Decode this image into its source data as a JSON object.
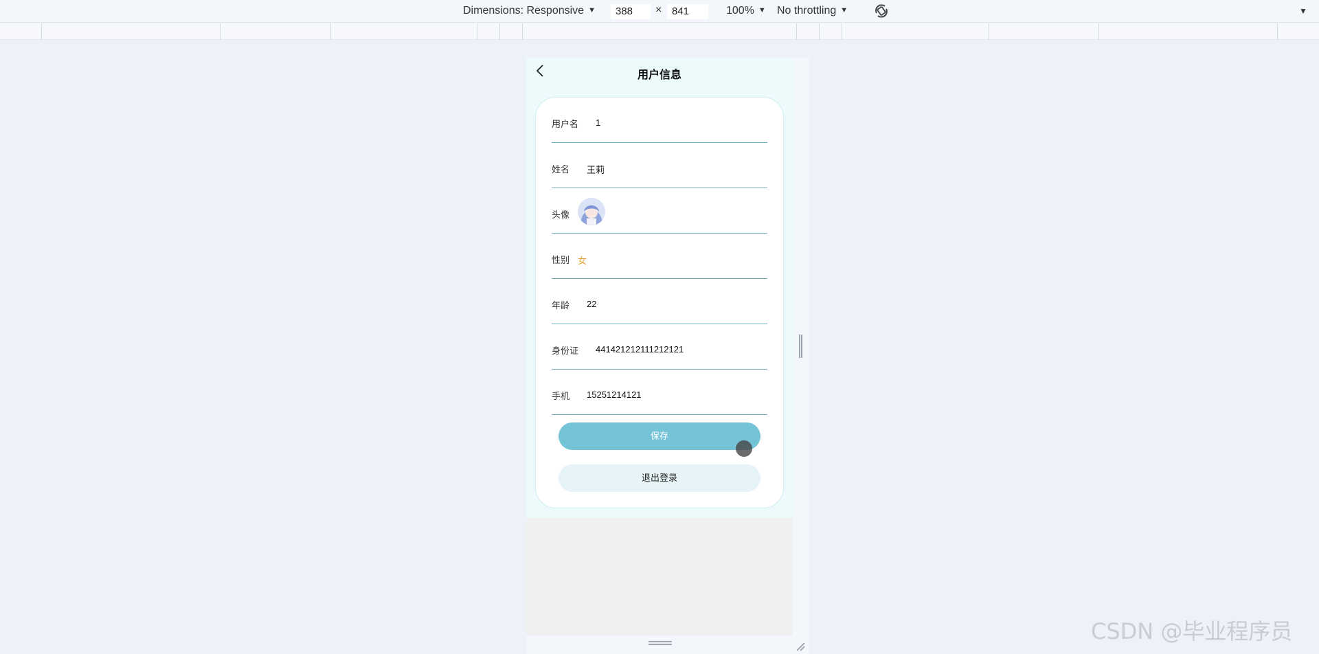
{
  "devtools": {
    "dimensions_label": "Dimensions: Responsive",
    "width_value": "388",
    "times_sign": "×",
    "height_value": "841",
    "zoom_label": "100%",
    "throttling_label": "No throttling",
    "dropdown_caret": "▼"
  },
  "app": {
    "title": "用户信息",
    "fields": [
      {
        "label": "用户名",
        "value": "1"
      },
      {
        "label": "姓名",
        "value": "王莉"
      },
      {
        "label": "头像",
        "value": ""
      },
      {
        "label": "性别",
        "value": "女"
      },
      {
        "label": "年龄",
        "value": "22"
      },
      {
        "label": "身份证",
        "value": "441421212111212121"
      },
      {
        "label": "手机",
        "value": "15251214121"
      }
    ],
    "save_label": "保存",
    "logout_label": "退出登录"
  },
  "watermark": "CSDN @毕业程序员",
  "colors": {
    "page_background": "#ecfafc",
    "primary_button": "#75c3d6",
    "secondary_button": "#e6f4f7",
    "gender_value": "#e6a23c",
    "row_divider": "#6fb2bd"
  }
}
